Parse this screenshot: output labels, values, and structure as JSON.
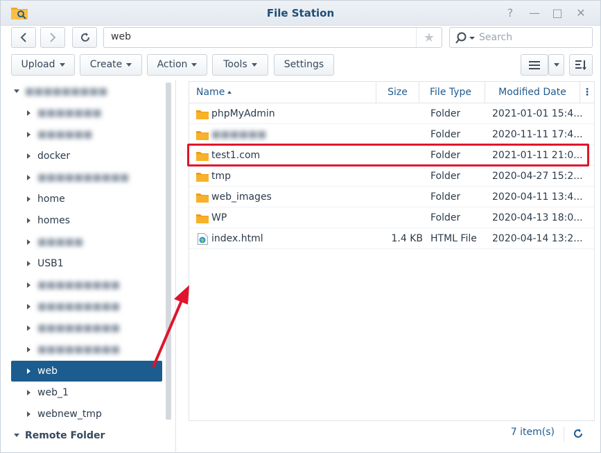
{
  "window": {
    "title": "File Station",
    "help_glyph": "?",
    "minimize_glyph": "—",
    "maximize_glyph": "□",
    "close_glyph": "✕"
  },
  "navbar": {
    "path": "web",
    "search_placeholder": "Search"
  },
  "toolbar": {
    "upload": "Upload",
    "create": "Create",
    "action": "Action",
    "tools": "Tools",
    "settings": "Settings"
  },
  "sidebar": {
    "items": [
      {
        "label": "docker"
      },
      {
        "label": "home"
      },
      {
        "label": "homes"
      },
      {
        "label": "USB1"
      },
      {
        "label": "web"
      },
      {
        "label": "web_1"
      },
      {
        "label": "webnew_tmp"
      }
    ],
    "remote_folder": "Remote Folder"
  },
  "filelist": {
    "columns": [
      "Name",
      "Size",
      "File Type",
      "Modified Date"
    ],
    "rows": [
      {
        "name": "phpMyAdmin",
        "size": "",
        "type": "Folder",
        "modified": "2021-01-01 15:4..."
      },
      {
        "name": "",
        "size": "",
        "type": "Folder",
        "modified": "2020-11-11 17:4..."
      },
      {
        "name": "test1.com",
        "size": "",
        "type": "Folder",
        "modified": "2021-01-11 21:0..."
      },
      {
        "name": "tmp",
        "size": "",
        "type": "Folder",
        "modified": "2020-04-27 15:2..."
      },
      {
        "name": "web_images",
        "size": "",
        "type": "Folder",
        "modified": "2020-04-11 13:4..."
      },
      {
        "name": "WP",
        "size": "",
        "type": "Folder",
        "modified": "2020-04-13 18:0..."
      },
      {
        "name": "index.html",
        "size": "1.4 KB",
        "type": "HTML File",
        "modified": "2020-04-14 13:2..."
      }
    ],
    "item_count": "7 item(s)"
  },
  "colors": {
    "selected_bg": "#1d5c8f",
    "highlight": "#e0142c",
    "folder": "#f7a823"
  }
}
